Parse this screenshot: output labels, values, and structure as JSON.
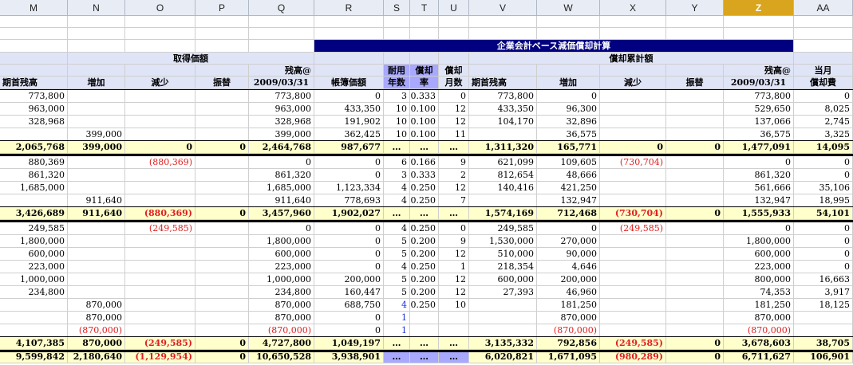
{
  "col_headers": [
    "M",
    "N",
    "O",
    "P",
    "Q",
    "R",
    "S",
    "T",
    "U",
    "V",
    "W",
    "X",
    "Y",
    "Z",
    "AA"
  ],
  "selected_col": "Z",
  "title": "企業会計ベース減価償却計算",
  "header": {
    "acq_group": "取得価額",
    "dep_group": "償却累計額",
    "balance_at": "残高@",
    "date": "2009/03/31",
    "current_month": "当月",
    "opening": "期首残高",
    "increase": "増加",
    "decrease": "減少",
    "transfer": "振替",
    "book_value": "帳簿価額",
    "life_1": "耐用",
    "life_2": "年数",
    "rate_1": "償却",
    "rate_2": "率",
    "months_1": "償却",
    "months_2": "月数",
    "monthly_dep": "償却費"
  },
  "rows": [
    {
      "style": "data",
      "v": [
        "773,800",
        "",
        "",
        "",
        "773,800",
        "0",
        "3",
        "0.333",
        "0",
        "773,800",
        "0",
        "",
        "",
        "773,800",
        "0"
      ]
    },
    {
      "style": "data",
      "v": [
        "963,000",
        "",
        "",
        "",
        "963,000",
        "433,350",
        "10",
        "0.100",
        "12",
        "433,350",
        "96,300",
        "",
        "",
        "529,650",
        "8,025"
      ]
    },
    {
      "style": "data",
      "v": [
        "328,968",
        "",
        "",
        "",
        "328,968",
        "191,902",
        "10",
        "0.100",
        "12",
        "104,170",
        "32,896",
        "",
        "",
        "137,066",
        "2,745"
      ]
    },
    {
      "style": "data",
      "v": [
        "",
        "399,000",
        "",
        "",
        "399,000",
        "362,425",
        "10",
        "0.100",
        "11",
        "",
        "36,575",
        "",
        "",
        "36,575",
        "3,325"
      ]
    },
    {
      "style": "total",
      "v": [
        "2,065,768",
        "399,000",
        "0",
        "0",
        "2,464,768",
        "987,677",
        "…",
        "…",
        "…",
        "1,311,320",
        "165,771",
        "0",
        "0",
        "1,477,091",
        "14,095"
      ]
    },
    {
      "style": "data",
      "v": [
        "880,369",
        "",
        "(880,369)",
        "",
        "0",
        "0",
        "6",
        "0.166",
        "9",
        "621,099",
        "109,605",
        "(730,704)",
        "",
        "0",
        "0"
      ]
    },
    {
      "style": "data",
      "v": [
        "861,320",
        "",
        "",
        "",
        "861,320",
        "0",
        "3",
        "0.333",
        "2",
        "812,654",
        "48,666",
        "",
        "",
        "861,320",
        "0"
      ]
    },
    {
      "style": "data",
      "v": [
        "1,685,000",
        "",
        "",
        "",
        "1,685,000",
        "1,123,334",
        "4",
        "0.250",
        "12",
        "140,416",
        "421,250",
        "",
        "",
        "561,666",
        "35,106"
      ]
    },
    {
      "style": "data",
      "v": [
        "",
        "911,640",
        "",
        "",
        "911,640",
        "778,693",
        "4",
        "0.250",
        "7",
        "",
        "132,947",
        "",
        "",
        "132,947",
        "18,995"
      ]
    },
    {
      "style": "total",
      "v": [
        "3,426,689",
        "911,640",
        "(880,369)",
        "0",
        "3,457,960",
        "1,902,027",
        "…",
        "…",
        "…",
        "1,574,169",
        "712,468",
        "(730,704)",
        "0",
        "1,555,933",
        "54,101"
      ]
    },
    {
      "style": "data",
      "v": [
        "249,585",
        "",
        "(249,585)",
        "",
        "0",
        "0",
        "4",
        "0.250",
        "0",
        "249,585",
        "0",
        "(249,585)",
        "",
        "0",
        "0"
      ]
    },
    {
      "style": "data",
      "v": [
        "1,800,000",
        "",
        "",
        "",
        "1,800,000",
        "0",
        "5",
        "0.200",
        "9",
        "1,530,000",
        "270,000",
        "",
        "",
        "1,800,000",
        "0"
      ]
    },
    {
      "style": "data",
      "v": [
        "600,000",
        "",
        "",
        "",
        "600,000",
        "0",
        "5",
        "0.200",
        "12",
        "510,000",
        "90,000",
        "",
        "",
        "600,000",
        "0"
      ]
    },
    {
      "style": "data",
      "v": [
        "223,000",
        "",
        "",
        "",
        "223,000",
        "0",
        "4",
        "0.250",
        "1",
        "218,354",
        "4,646",
        "",
        "",
        "223,000",
        "0"
      ]
    },
    {
      "style": "data",
      "v": [
        "1,000,000",
        "",
        "",
        "",
        "1,000,000",
        "200,000",
        "5",
        "0.200",
        "12",
        "600,000",
        "200,000",
        "",
        "",
        "800,000",
        "16,663"
      ]
    },
    {
      "style": "data",
      "v": [
        "234,800",
        "",
        "",
        "",
        "234,800",
        "160,447",
        "5",
        "0.200",
        "12",
        "27,393",
        "46,960",
        "",
        "",
        "74,353",
        "3,917"
      ]
    },
    {
      "style": "data",
      "v": [
        "",
        "870,000",
        "",
        "",
        "870,000",
        "688,750",
        "4",
        "0.250",
        "10",
        "",
        "181,250",
        "",
        "",
        "181,250",
        "18,125"
      ]
    },
    {
      "style": "data",
      "v": [
        "",
        "870,000",
        "",
        "",
        "870,000",
        "0",
        "1",
        "",
        "",
        "",
        "870,000",
        "",
        "",
        "870,000",
        ""
      ]
    },
    {
      "style": "data",
      "v": [
        "",
        "(870,000)",
        "",
        "",
        "(870,000)",
        "0",
        "1",
        "",
        "",
        "",
        "(870,000)",
        "",
        "",
        "(870,000)",
        ""
      ]
    },
    {
      "style": "total",
      "v": [
        "4,107,385",
        "870,000",
        "(249,585)",
        "0",
        "4,727,800",
        "1,049,197",
        "…",
        "…",
        "…",
        "3,135,332",
        "792,856",
        "(249,585)",
        "0",
        "3,678,603",
        "38,705"
      ]
    },
    {
      "style": "grand",
      "v": [
        "9,599,842",
        "2,180,640",
        "(1,129,954)",
        "0",
        "10,650,528",
        "3,938,901",
        "…",
        "…",
        "…",
        "6,020,821",
        "1,671,095",
        "(980,289)",
        "0",
        "6,711,627",
        "106,901"
      ]
    }
  ],
  "blue_cells": [
    [
      16,
      6
    ],
    [
      17,
      6
    ],
    [
      18,
      6
    ]
  ]
}
